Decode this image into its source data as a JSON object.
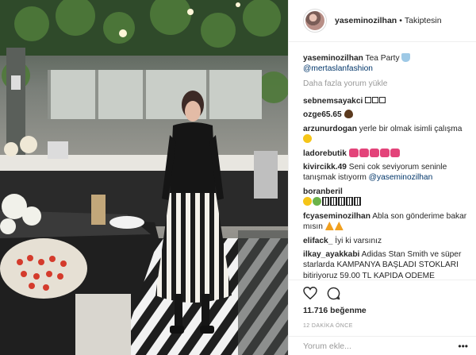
{
  "post": {
    "username": "yaseminozilhan",
    "follow_label": "Takiptesin",
    "caption_user": "yaseminozilhan",
    "caption_text": "Tea Party",
    "caption_mention": "@mertaslanfashion",
    "load_more": "Daha fazla yorum yükle"
  },
  "comments": [
    {
      "user": "sebnemsayakci",
      "text": "",
      "icons": [
        "e-sq",
        "e-sq",
        "e-sq"
      ]
    },
    {
      "user": "ozge65.65",
      "text": "",
      "icons": [
        "e-drop"
      ]
    },
    {
      "user": "arzunurdogan",
      "text": "yerle bir olmak isimli çalışma",
      "icons_after": [
        "e-yellow"
      ]
    },
    {
      "user": "ladorebutik",
      "text": "",
      "icons": [
        "e-bow",
        "e-bow",
        "e-bow",
        "e-bow",
        "e-bow"
      ]
    },
    {
      "user": "kivircikk.49",
      "text": "Seni cok seviyorum seninle tanışmak istıyorm",
      "mention": "@yaseminozilhan"
    },
    {
      "user": "boranberil",
      "text": "",
      "icons": [
        "e-yellow",
        "e-green",
        "e-box",
        "e-box",
        "e-box",
        "e-box",
        "e-box"
      ]
    },
    {
      "user": "fcyaseminozilhan",
      "text": "Abla son gönderime bakar mısın",
      "icons": [
        "e-warn",
        "e-warn"
      ]
    },
    {
      "user": "elifack_",
      "text": "İyi ki varsınız"
    },
    {
      "user": "ilkay_ayakkabi",
      "text": "Adidas Stan Smith ve süper starlarda KAMPANYA BAŞLADI STOKLARI bitiriyoruz 59.00 TL KAPIDA ODEME"
    }
  ],
  "actions": {
    "likes": "11.716 beğenme",
    "time": "12 DAKİKA ÖNCE",
    "comment_placeholder": "Yorum ekle...",
    "more_icon": "ellipsis-icon"
  },
  "colors": {
    "link": "#003569",
    "muted": "#999999",
    "border": "#efefef"
  }
}
